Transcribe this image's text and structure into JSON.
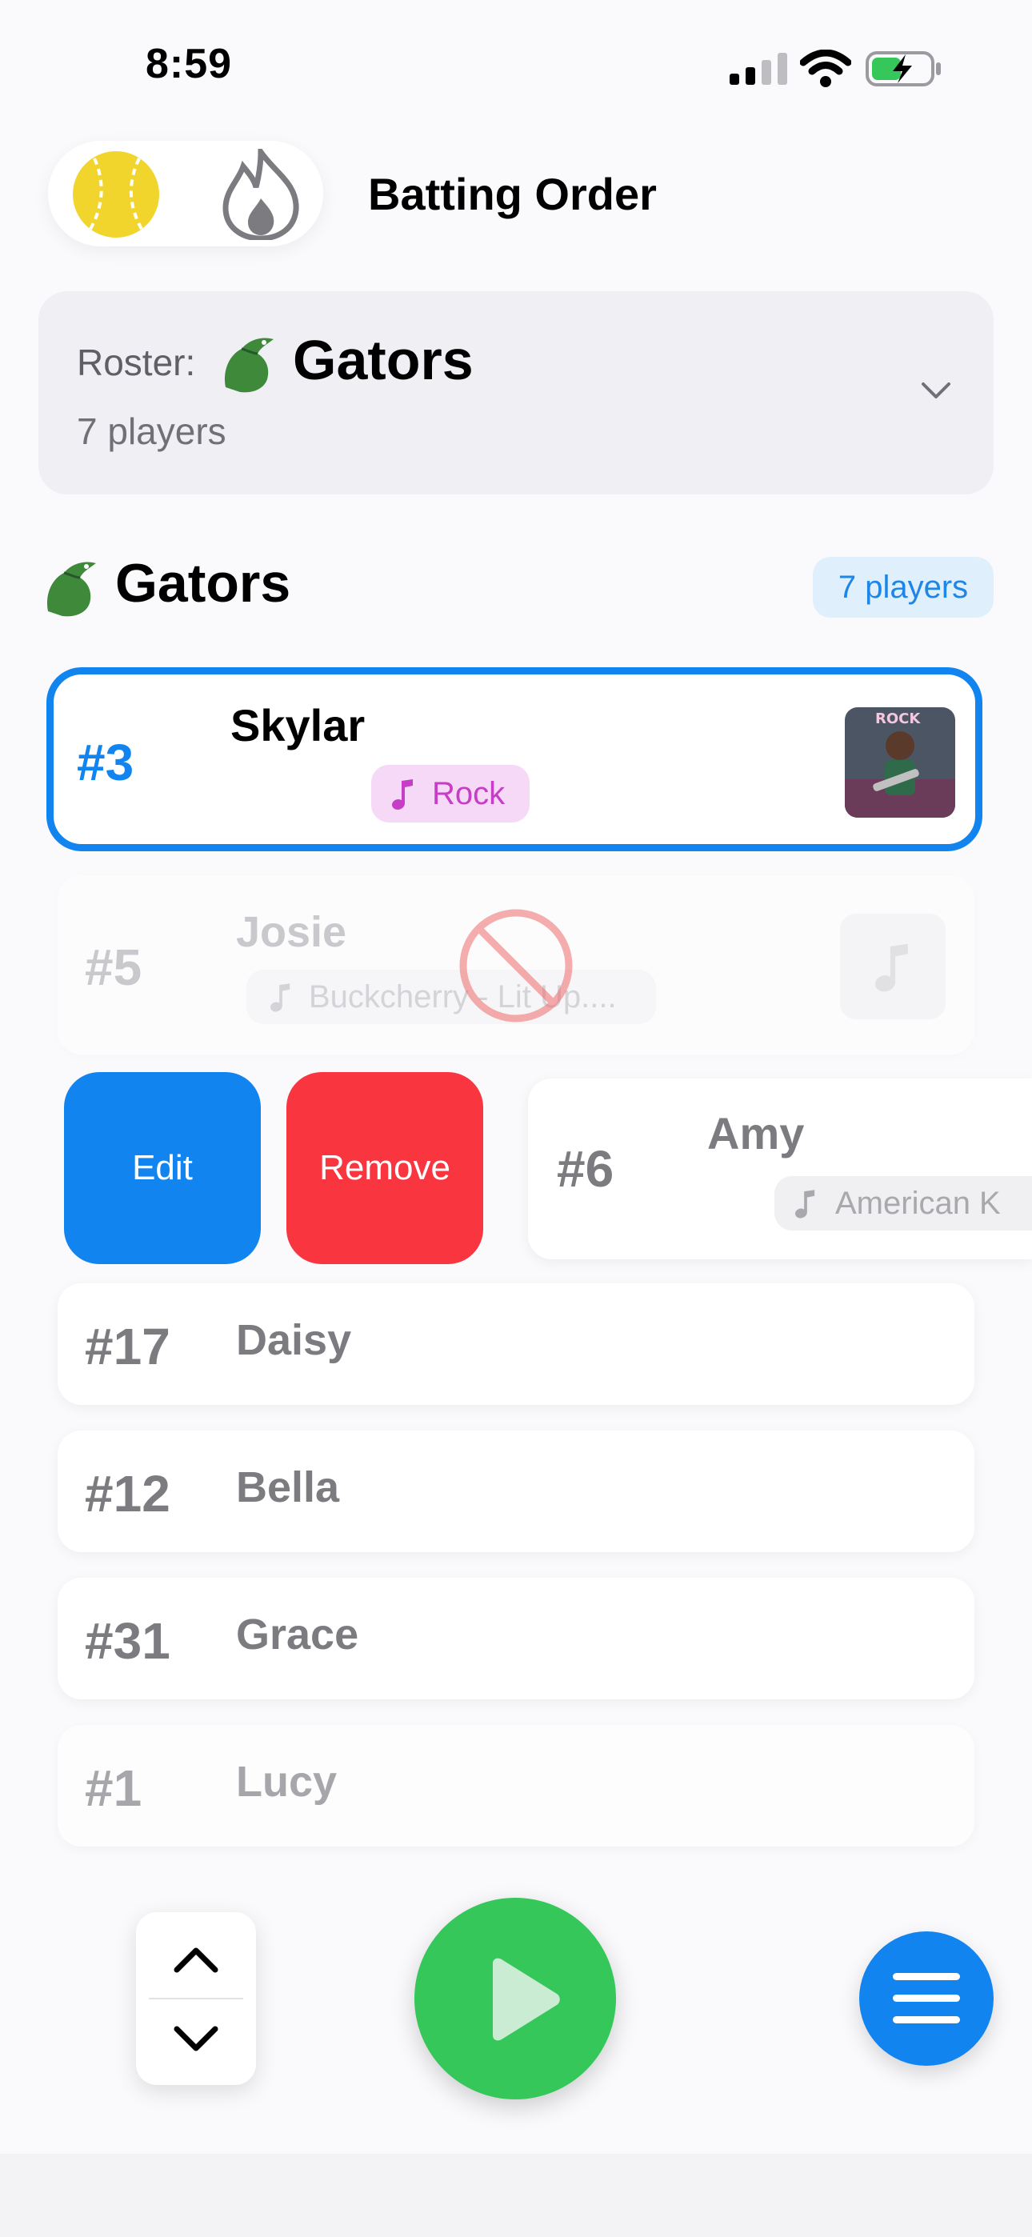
{
  "status_bar": {
    "time": "8:59"
  },
  "header": {
    "title": "Batting Order",
    "icons": [
      "softball-icon",
      "flame-icon"
    ]
  },
  "roster": {
    "prefix": "Roster:",
    "team": "Gators",
    "count": "7 players"
  },
  "team": {
    "name": "Gators",
    "badge": "7 players"
  },
  "players": [
    {
      "number": "#3",
      "name": "Skylar",
      "song": "Rock",
      "state": "selected"
    },
    {
      "number": "#5",
      "name": "Josie",
      "song": "Buckcherry - Lit Up....",
      "state": "dragging"
    },
    {
      "number": "#6",
      "name": "Amy",
      "song": "American K",
      "state": "swiped"
    },
    {
      "number": "#17",
      "name": "Daisy"
    },
    {
      "number": "#12",
      "name": "Bella"
    },
    {
      "number": "#31",
      "name": "Grace"
    },
    {
      "number": "#1",
      "name": "Lucy"
    }
  ],
  "swipe_actions": {
    "edit": "Edit",
    "remove": "Remove"
  },
  "colors": {
    "accent": "#1184f0",
    "danger": "#f9363f",
    "play": "#35c759",
    "chip_rock_bg": "#f6d9f6",
    "chip_rock_fg": "#c53ec5"
  }
}
